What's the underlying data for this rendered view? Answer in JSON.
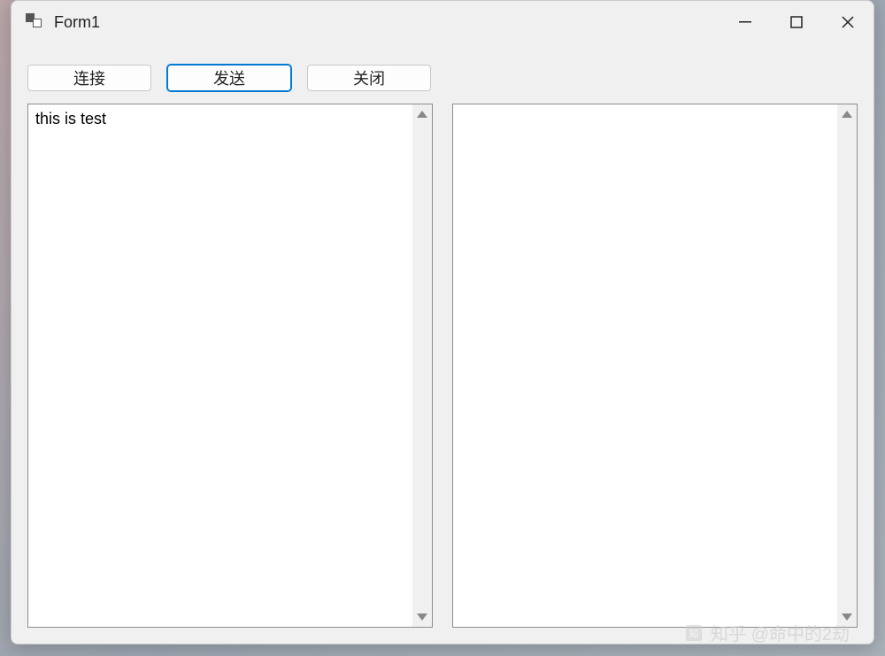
{
  "window": {
    "title": "Form1"
  },
  "toolbar": {
    "connect_label": "连接",
    "send_label": "发送",
    "close_label": "关闭"
  },
  "textareas": {
    "left_value": "this is test",
    "right_value": ""
  },
  "watermark": "知乎 @命中的2劫"
}
